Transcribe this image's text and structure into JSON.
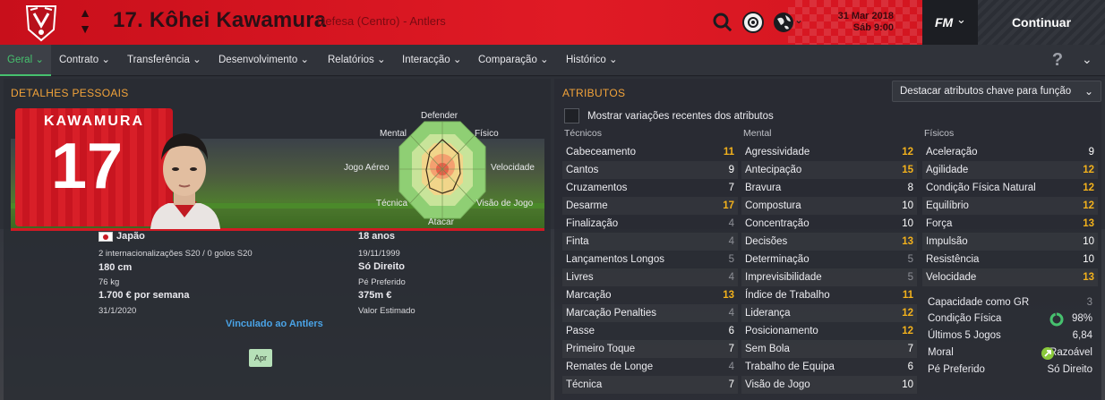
{
  "header": {
    "player_title": "17. Kôhei Kawamura",
    "subtitle": "Defesa (Centro) - Antlers",
    "date": "31 Mar 2018",
    "time": "Sáb 9:00",
    "fm_logo": "FM",
    "continue_label": "Continuar"
  },
  "nav": {
    "items": [
      "Geral",
      "Contrato",
      "Transferência",
      "Desenvolvimento",
      "Relatórios",
      "Interacção",
      "Comparação",
      "Histórico"
    ],
    "caret": "⌄"
  },
  "personal": {
    "section_title": "DETALHES PESSOAIS",
    "shirt_name": "KAWAMURA",
    "shirt_number": "17",
    "nationality": "Japão",
    "caps": "2 internacionalizações S20 / 0 golos S20",
    "height": "180 cm",
    "weight": "76 kg",
    "wage": "1.700 € por semana",
    "contract_end": "31/1/2020",
    "age": "18 anos",
    "dob": "19/11/1999",
    "foot": "Só Direito",
    "foot_label": "Pé Preferido",
    "value": "375m €",
    "value_label": "Valor Estimado",
    "linked": "Vinculado ao Antlers",
    "apr_button": "Apr"
  },
  "radar": {
    "labels": [
      "Defender",
      "Físico",
      "Velocidade",
      "Visão de Jogo",
      "Atacar",
      "Técnica",
      "Jogo Aéreo",
      "Mental"
    ]
  },
  "attributes": {
    "section_title": "ATRIBUTOS",
    "dropdown": "Destacar atributos chave para função",
    "checkbox_label": "Mostrar variações recentes dos atributos",
    "col_headers": [
      "Técnicos",
      "Mental",
      "Físicos"
    ],
    "tecnicos": [
      {
        "name": "Cabeceamento",
        "value": "11",
        "tone": "gold"
      },
      {
        "name": "Cantos",
        "value": "9",
        "tone": "white"
      },
      {
        "name": "Cruzamentos",
        "value": "7",
        "tone": "white"
      },
      {
        "name": "Desarme",
        "value": "17",
        "tone": "gold"
      },
      {
        "name": "Finalização",
        "value": "4",
        "tone": "gray"
      },
      {
        "name": "Finta",
        "value": "4",
        "tone": "gray"
      },
      {
        "name": "Lançamentos Longos",
        "value": "5",
        "tone": "gray"
      },
      {
        "name": "Livres",
        "value": "4",
        "tone": "gray"
      },
      {
        "name": "Marcação",
        "value": "13",
        "tone": "gold"
      },
      {
        "name": "Marcação Penalties",
        "value": "4",
        "tone": "gray"
      },
      {
        "name": "Passe",
        "value": "6",
        "tone": "white"
      },
      {
        "name": "Primeiro Toque",
        "value": "7",
        "tone": "white"
      },
      {
        "name": "Remates de Longe",
        "value": "4",
        "tone": "gray"
      },
      {
        "name": "Técnica",
        "value": "7",
        "tone": "white"
      }
    ],
    "mental": [
      {
        "name": "Agressividade",
        "value": "12",
        "tone": "gold"
      },
      {
        "name": "Antecipação",
        "value": "15",
        "tone": "gold"
      },
      {
        "name": "Bravura",
        "value": "8",
        "tone": "white"
      },
      {
        "name": "Compostura",
        "value": "10",
        "tone": "white"
      },
      {
        "name": "Concentração",
        "value": "10",
        "tone": "white"
      },
      {
        "name": "Decisões",
        "value": "13",
        "tone": "gold"
      },
      {
        "name": "Determinação",
        "value": "5",
        "tone": "gray"
      },
      {
        "name": "Imprevisibilidade",
        "value": "5",
        "tone": "gray"
      },
      {
        "name": "Índice de Trabalho",
        "value": "11",
        "tone": "gold"
      },
      {
        "name": "Liderança",
        "value": "12",
        "tone": "gold"
      },
      {
        "name": "Posicionamento",
        "value": "12",
        "tone": "gold"
      },
      {
        "name": "Sem Bola",
        "value": "7",
        "tone": "white"
      },
      {
        "name": "Trabalho de Equipa",
        "value": "6",
        "tone": "white"
      },
      {
        "name": "Visão de Jogo",
        "value": "10",
        "tone": "white"
      }
    ],
    "fisicos": [
      {
        "name": "Aceleração",
        "value": "9",
        "tone": "white"
      },
      {
        "name": "Agilidade",
        "value": "12",
        "tone": "gold"
      },
      {
        "name": "Condição Física Natural",
        "value": "12",
        "tone": "gold"
      },
      {
        "name": "Equilíbrio",
        "value": "12",
        "tone": "gold"
      },
      {
        "name": "Força",
        "value": "13",
        "tone": "gold"
      },
      {
        "name": "Impulsão",
        "value": "10",
        "tone": "white"
      },
      {
        "name": "Resistência",
        "value": "10",
        "tone": "white"
      },
      {
        "name": "Velocidade",
        "value": "13",
        "tone": "gold"
      }
    ],
    "summary": [
      {
        "name": "Capacidade como GR",
        "value": "3"
      },
      {
        "name": "Condição Física",
        "value": "98%"
      },
      {
        "name": "Últimos 5 Jogos",
        "value": "6,84"
      },
      {
        "name": "Moral",
        "value": "Razoável"
      },
      {
        "name": "Pé Preferido",
        "value": "Só Direito"
      }
    ]
  },
  "colors": {
    "header_red": "#d9121f",
    "accent_green": "#46c16e",
    "section_orange": "#f2a33a",
    "highlight_gold": "#f2b11c"
  }
}
